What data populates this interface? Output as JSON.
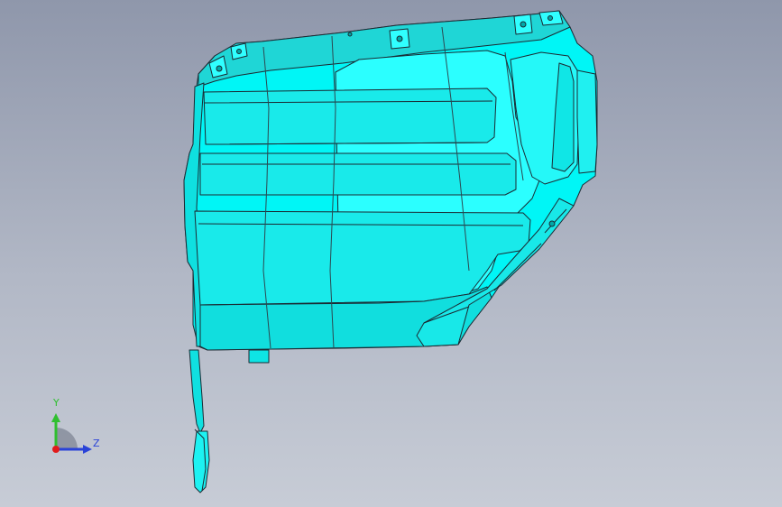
{
  "viewport": {
    "model_color": "#00ffff",
    "edge_color": "#1b2a33",
    "background_top": "#8f97ab",
    "background_bottom": "#c7ccd6"
  },
  "triad": {
    "y_label": "Y",
    "z_label": "Z",
    "y_color": "#2fbf2f",
    "z_color": "#2a43d8",
    "origin_color": "#e11b1b"
  }
}
